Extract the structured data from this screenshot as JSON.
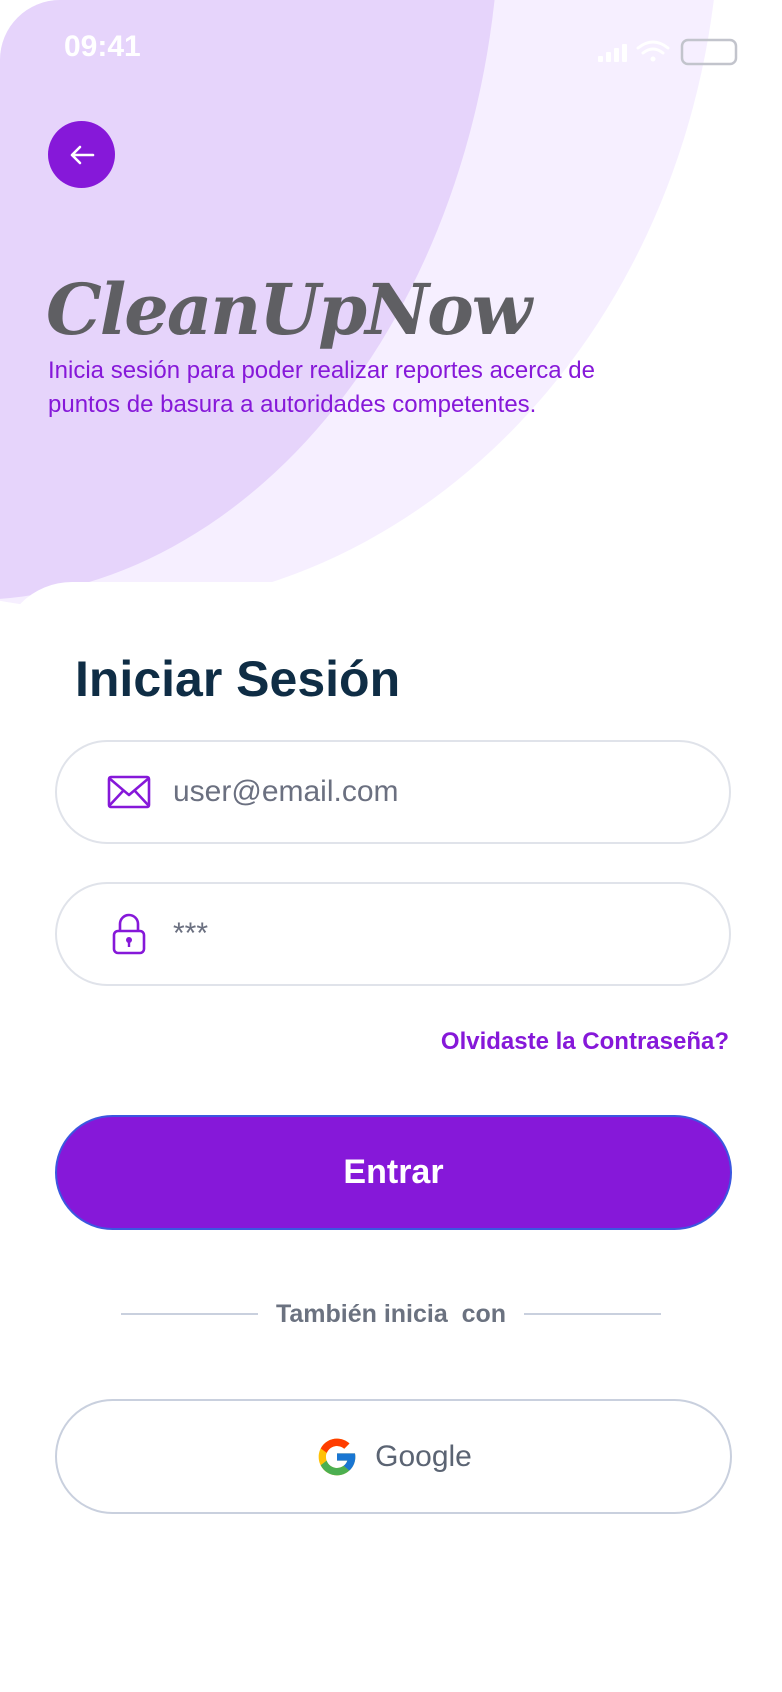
{
  "status_bar": {
    "time": "09:41"
  },
  "icons": {
    "back": "arrow-left-icon",
    "email": "envelope-icon",
    "password": "lock-icon",
    "google": "google-logo-icon"
  },
  "brand": {
    "name": "CleanUpNow",
    "subtitle": "Inicia sesión para poder realizar reportes acerca de puntos de basura a autoridades competentes."
  },
  "login": {
    "title": "Iniciar Sesión",
    "email_value": "user@email.com",
    "password_value": "***",
    "forgot_label": "Olvidaste la Contraseña?",
    "submit_label": "Entrar",
    "alt_label": "También inicia  con",
    "google_label": "Google"
  },
  "colors": {
    "accent": "#8618d9",
    "heading": "#0f2d45",
    "bg_inner": "#e6d4fb",
    "bg_outer": "#f6efff"
  }
}
